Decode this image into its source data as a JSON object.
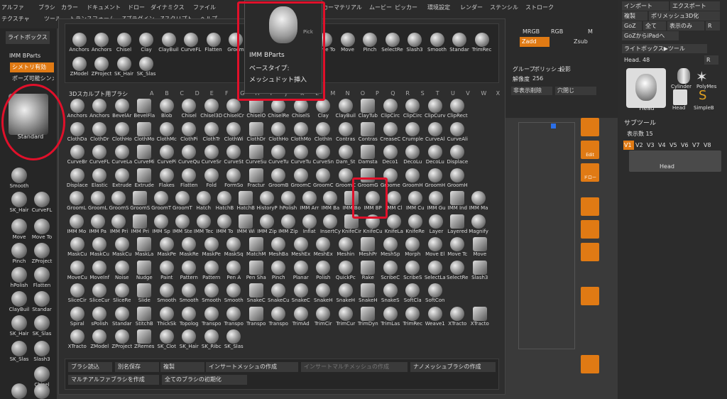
{
  "menubar": {
    "row1": [
      "アルファ",
      "ブラシ",
      "カラー",
      "ドキュメント",
      "ドロー",
      "ダイナミクス",
      "ファイル",
      "マーカー",
      "マテリアル",
      "ムービー",
      "ピッカー",
      "環境設定",
      "レンダー",
      "ステンシル",
      "ストローク"
    ],
    "row2": [
      "テクスチャ",
      "ツール",
      "トランスフォーム",
      "Zプラグイン",
      "Zスクリプト",
      "ヘルプ"
    ]
  },
  "left_panel": {
    "lightbox": "ライトボックス",
    "imm_label": "IMM BParts",
    "symmetry": "シメトリ有効",
    "pose": "ポーズ可能シンメ",
    "current_brush": "Standard",
    "tools": [
      "Smooth",
      "SK_Hair",
      "CurveFL",
      "Move",
      "Move To",
      "Pinch",
      "ZProject",
      "hPolish",
      "Flatten",
      "ClayBuil",
      "Standar",
      "SK_Hair",
      "SK_Slas",
      "Slash3",
      "SK_Slas",
      "Chisel",
      "SK_Hair",
      "GroomS"
    ]
  },
  "popup": {
    "recent": {
      "row1": [
        "Anchors",
        "Anchors",
        "Chisel",
        "Clay",
        "ClayBuil",
        "CurveFL",
        "Flatten",
        "Groom",
        "",
        "",
        "",
        "Move To",
        "Move",
        "Pinch",
        "SelectRe",
        "Slash3",
        "Smooth",
        "Standar",
        "TrimRec"
      ],
      "row2": [
        "ZModel",
        "ZProject",
        "SK_Hair",
        "SK_Slas"
      ]
    },
    "library_title": "3Dスカルプト用ブラシ",
    "letters": [
      "A",
      "B",
      "C",
      "D",
      "E",
      "F",
      "G",
      "H",
      "I",
      "J",
      "K",
      "L",
      "M",
      "N",
      "O",
      "P",
      "Q",
      "R",
      "S",
      "T",
      "U",
      "V",
      "W",
      "X",
      "Y",
      "Z"
    ],
    "grid_rows": [
      [
        "Anchors",
        "Anchors",
        "BevelAr",
        "BevelFla",
        "Blob",
        "Chisel",
        "Chisel3D",
        "ChiselCr",
        "ChiselO",
        "ChiselRe",
        "ChiselS",
        "Clay",
        "ClayBuil",
        "ClayTub",
        "ClipCirc",
        "ClipCirc",
        "ClipCurv",
        "ClipRect"
      ],
      [
        "ClothDa",
        "ClothDr",
        "ClothHo",
        "ClothMo",
        "ClothMc",
        "ClothPi",
        "ClothTr",
        "ClothWi",
        "ClothDr",
        "ClothHo",
        "ClothMo",
        "ClothIn",
        "Contras",
        "Contras",
        "CreaseC",
        "Crumple",
        "CurveAl",
        "CurveAli"
      ],
      [
        "CurveBr",
        "CurveFL",
        "CurveLa",
        "CurveMi",
        "CurvePi",
        "CurveQu",
        "CurveSr",
        "CurveSt",
        "CurveSu",
        "CurveTu",
        "CurveTu",
        "CurveSn",
        "Dam_St",
        "Damsta",
        "Deco1",
        "DecoLu",
        "DecoLu",
        "Displace"
      ],
      [
        "Displace",
        "Elastic",
        "Extrude",
        "Extrude",
        "Flakes",
        "Flatten",
        "Fold",
        "FormSo",
        "Fractur",
        "GroomB",
        "GroomC",
        "GroomC",
        "GroomC",
        "GroomG",
        "Groome",
        "GroomH",
        "GroomH",
        "GroomH"
      ],
      [
        "GroomL",
        "GroomL",
        "GroomS",
        "GroomS",
        "GroomT",
        "GroomT",
        "Hatch",
        "HatchB",
        "HatchB",
        "HistoryP",
        "hPolish",
        "IMM Arr",
        "IMM Ba",
        "IMM Bo",
        "IMM BP",
        "IMM Cl",
        "IMM Cu",
        "IMM Gu",
        "IMM Ind",
        "IMM Ma"
      ],
      [
        "IMM Mo",
        "IMM Pa",
        "IMM Pri",
        "IMM Pri",
        "IMM Sp",
        "IMM Ste",
        "IMM Tec",
        "IMM To",
        "IMM Wi",
        "IMM Zip",
        "IMM Zip",
        "Inflat",
        "InsertCy",
        "KnifeCir",
        "KnifeCu",
        "KnifeLa",
        "KnifeRe",
        "Layer",
        "Layered",
        "Magnify"
      ],
      [
        "MaskCu",
        "MaskCu",
        "MaskCu",
        "MaskLa",
        "MaskPe",
        "MaskRe",
        "MaskPe",
        "MaskSq",
        "MatchM",
        "MeshBa",
        "MeshEx",
        "MeshEx",
        "Meshin",
        "MeshPr",
        "MeshSp",
        "Morph",
        "Move El",
        "Move Tc",
        "Move"
      ],
      [
        "MoveCu",
        "MoveInf",
        "Noise",
        "Nudge",
        "Paint",
        "Pattern",
        "Pattern",
        "Pen A",
        "Pen Sha",
        "Pinch",
        "Planar",
        "Polish",
        "QuickPc",
        "Rake",
        "ScribeC",
        "ScribeS",
        "SelectLa",
        "SelectRe",
        "Slash3"
      ],
      [
        "SliceCir",
        "SliceCur",
        "SliceRe",
        "Slide",
        "Smooth",
        "Smooth",
        "Smooth",
        "Smooth",
        "SnakeC",
        "SnakeCu",
        "SnakeC",
        "SnakeH",
        "SnakeH",
        "SnakeH",
        "SnakeS",
        "SoftCla",
        "SoftCon"
      ],
      [
        "Spiral",
        "sPolish",
        "Standar",
        "StitchB",
        "ThickSk",
        "Topolog",
        "Transpo",
        "Transpo",
        "Transpo",
        "Transpo",
        "TrimAd",
        "TrimCir",
        "TrimCur",
        "TrimDyn",
        "TrimLas",
        "TrimRec",
        "Weave1",
        "XTracto",
        "XTracto"
      ],
      [
        "XTracto",
        "ZModel",
        "ZProject",
        "ZRemes",
        "SK_Clot",
        "SK_Hair",
        "SK_Ribc",
        "SK_Slas"
      ]
    ],
    "bottom": {
      "row1": [
        "ブラシ読込",
        "別名保存",
        "複製",
        "インサートメッシュの作成",
        "インサートマルチメッシュの作成",
        "ナノメッシュブラシの作成"
      ],
      "row2": [
        "マルチアルファブラシを作成",
        "全てのブラシの初期化"
      ]
    }
  },
  "tooltip": {
    "title": "IMM BParts",
    "line2": "ベースタイプ:",
    "line3": "メッシュドット挿入",
    "pick": "Pick"
  },
  "mid_panel": {
    "mrgb": "MRGB",
    "rgb": "RGB",
    "m": "M",
    "zadd": "Zadd",
    "zsub": "Zsub",
    "group_label": "グループ",
    "polish": "ポリッシュ",
    "projection": "投影",
    "resolution_label": "解像度",
    "resolution_value": "256",
    "hide_delete": "非表示削除",
    "hole_close": "穴閉じ"
  },
  "orange_buttons": [
    "",
    "Edit",
    "ドロー",
    "",
    "",
    "",
    "",
    ""
  ],
  "right_panel": {
    "row1": [
      "インポート",
      "エクスポート"
    ],
    "row2": [
      "複製",
      "ポリメッシュ3D化"
    ],
    "row3": [
      "GoZ",
      "全て",
      "表示のみ",
      "R"
    ],
    "row4": [
      "GoZからiPadへ"
    ],
    "lightbox_tool": "ライトボックス▶ツール",
    "head_label": "Head. 48",
    "head_value": "R",
    "thumbs": [
      "Head",
      "Cylinder",
      "PolyMes",
      "Head",
      "SimpleB"
    ],
    "subtool_title": "サブツール",
    "visible_count": "表示数 15",
    "versions": [
      "V1",
      "V2",
      "V3",
      "V4",
      "V5",
      "V6",
      "V7",
      "V8"
    ],
    "subtool_item": "Head"
  }
}
